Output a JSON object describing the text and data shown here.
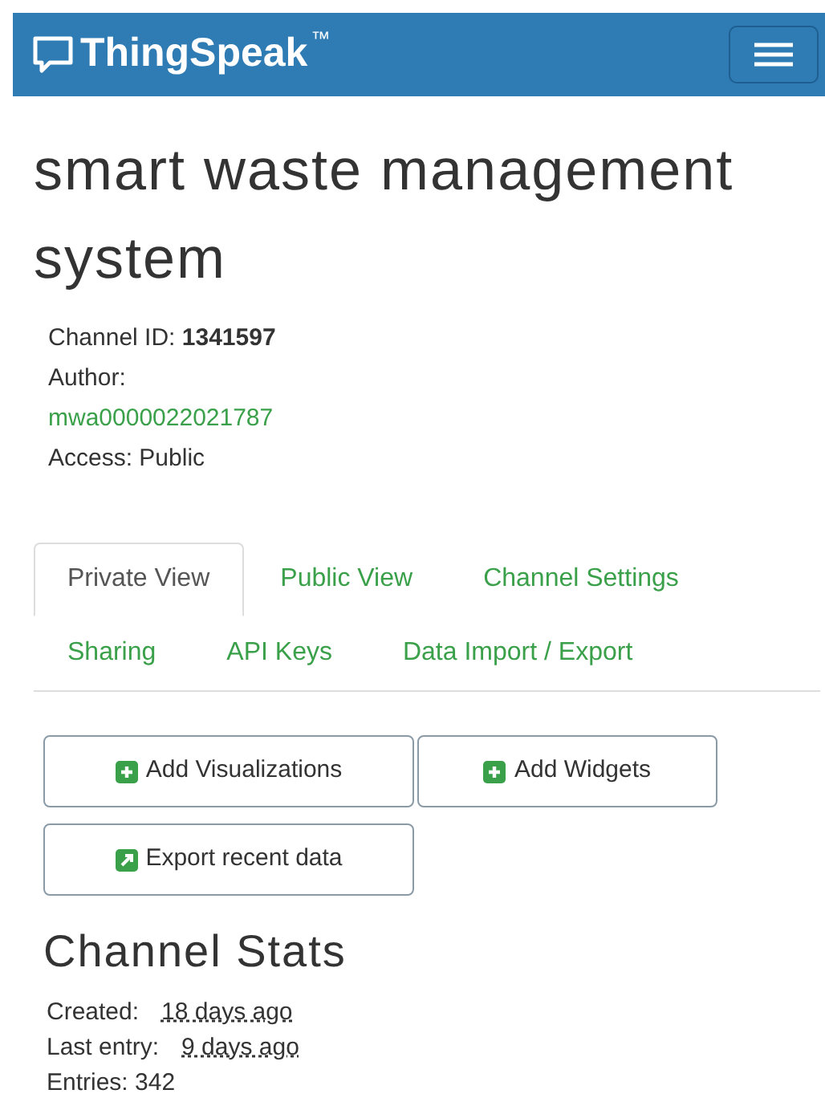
{
  "navbar": {
    "brand": "ThingSpeak",
    "trademark": "™"
  },
  "title": "smart waste management system",
  "info": [
    {
      "kind": "bold",
      "label": "Channel ID:",
      "value": "1341597"
    },
    {
      "kind": "label",
      "label": "Author:"
    },
    {
      "kind": "link",
      "value": "mwa0000022021787"
    },
    {
      "kind": "plain",
      "label": "Access:",
      "value": "Public"
    }
  ],
  "tabs": [
    {
      "label": "Private View",
      "selected": true
    },
    {
      "label": "Public View",
      "selected": false
    },
    {
      "label": "Channel Settings",
      "selected": false
    },
    {
      "label": "Sharing",
      "selected": false
    },
    {
      "label": "API Keys",
      "selected": false
    },
    {
      "label": "Data Import / Export",
      "selected": false
    }
  ],
  "buttons": [
    {
      "label": "Add Visualizations",
      "kind": "plus"
    },
    {
      "label": "Add Widgets",
      "kind": "plus"
    },
    {
      "label": "Export recent data",
      "kind": "export"
    }
  ],
  "stats": {
    "heading": "Channel Stats",
    "items": [
      {
        "label": "Created:",
        "value": "18 days ago",
        "kind": "time"
      },
      {
        "label": "Last entry:",
        "value": "9 days ago",
        "kind": "time"
      },
      {
        "label": "Entries:",
        "value": "342",
        "kind": "plain"
      }
    ]
  }
}
